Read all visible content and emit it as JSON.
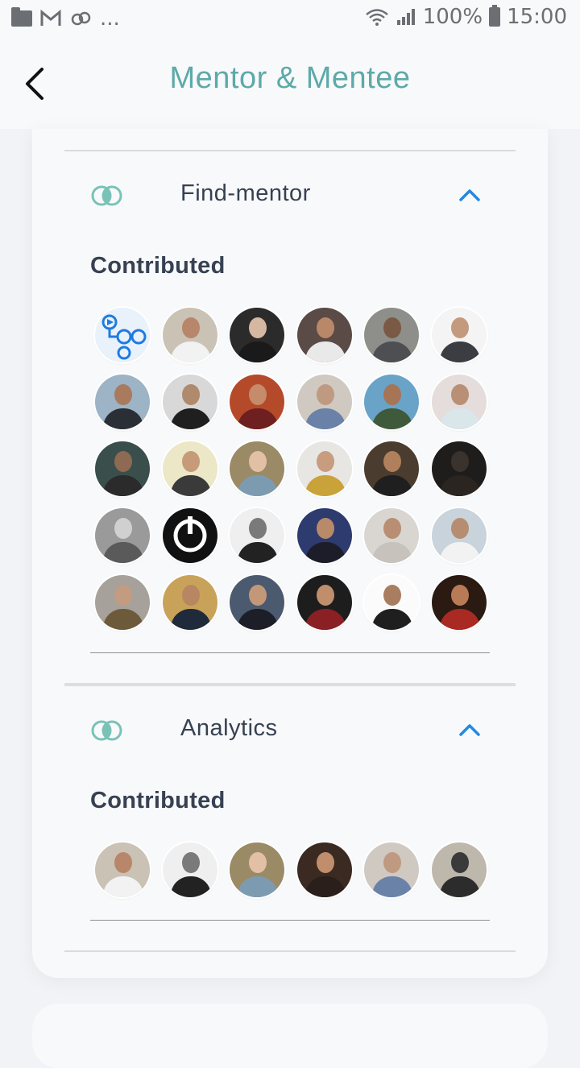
{
  "status_bar": {
    "left_overflow": "...",
    "battery": "100%",
    "time": "15:00"
  },
  "header": {
    "title": "Mentor & Mentee"
  },
  "sections": [
    {
      "title": "Find-mentor",
      "subheading": "Contributed",
      "avatars": [
        {
          "bg": "#e9f1fb",
          "head": "#1e7be0",
          "body": "#1e7be0",
          "kind": "logo"
        },
        {
          "bg": "#c9c2b5",
          "head": "#b8866a",
          "body": "#f2f2f2"
        },
        {
          "bg": "#2b2b2b",
          "head": "#d6b7a2",
          "body": "#1a1a1a"
        },
        {
          "bg": "#5a4b46",
          "head": "#b98868",
          "body": "#e9e9e9"
        },
        {
          "bg": "#8e8f8a",
          "head": "#7a5a44",
          "body": "#4d4f52"
        },
        {
          "bg": "#f4f4f4",
          "head": "#c49a7e",
          "body": "#3b3d42"
        },
        {
          "bg": "#9db3c6",
          "head": "#a87a5e",
          "body": "#2a2f36"
        },
        {
          "bg": "#d8d8d8",
          "head": "#b08a6d",
          "body": "#1f1f1f"
        },
        {
          "bg": "#b54a2a",
          "head": "#c68b6a",
          "body": "#6e1f1f"
        },
        {
          "bg": "#cfc9c2",
          "head": "#c09a80",
          "body": "#6a82a8"
        },
        {
          "bg": "#6aa3c8",
          "head": "#a57556",
          "body": "#3f5a3a"
        },
        {
          "bg": "#e5dcdc",
          "head": "#b98f76",
          "body": "#d9e6ea"
        },
        {
          "bg": "#3a4e4c",
          "head": "#8e6a52",
          "body": "#2b2b2b"
        },
        {
          "bg": "#ece7c6",
          "head": "#c79a78",
          "body": "#3a3a3a"
        },
        {
          "bg": "#9b8a66",
          "head": "#e2c0a6",
          "body": "#7d9bb0"
        },
        {
          "bg": "#e8e6e3",
          "head": "#c89c7f",
          "body": "#c9a23a"
        },
        {
          "bg": "#4a3c2f",
          "head": "#b07f5c",
          "body": "#1f1f1f"
        },
        {
          "bg": "#1f1d1b",
          "head": "#3a322c",
          "body": "#2a2520"
        },
        {
          "bg": "#9a9a9a",
          "head": "#d0d0d0",
          "body": "#5a5a5a"
        },
        {
          "bg": "#111111",
          "head": "#ffffff",
          "body": "#ffffff",
          "kind": "logo-dark"
        },
        {
          "bg": "#efefef",
          "head": "#7a7a7a",
          "body": "#222222"
        },
        {
          "bg": "#2d3b6e",
          "head": "#b88a6a",
          "body": "#1d1d2a"
        },
        {
          "bg": "#d9d6d2",
          "head": "#b98e72",
          "body": "#c7c2bb"
        },
        {
          "bg": "#c8d3db",
          "head": "#b68d70",
          "body": "#f2f2f2"
        },
        {
          "bg": "#a6a19a",
          "head": "#c39b80",
          "body": "#6d5a3a"
        },
        {
          "bg": "#c9a25a",
          "head": "#b88662",
          "body": "#1f2a3a"
        },
        {
          "bg": "#4c5a70",
          "head": "#c29878",
          "body": "#1c1f27"
        },
        {
          "bg": "#1d1d1d",
          "head": "#c08e6c",
          "body": "#8a1f24"
        },
        {
          "bg": "#fbfbfb",
          "head": "#a97d60",
          "body": "#1f1f1f"
        },
        {
          "bg": "#2a1a12",
          "head": "#b97a56",
          "body": "#a82a22"
        }
      ]
    },
    {
      "title": "Analytics",
      "subheading": "Contributed",
      "avatars": [
        {
          "bg": "#c9c2b5",
          "head": "#b8866a",
          "body": "#f2f2f2"
        },
        {
          "bg": "#efefef",
          "head": "#7a7a7a",
          "body": "#222222"
        },
        {
          "bg": "#9b8a66",
          "head": "#e2c0a6",
          "body": "#7d9bb0"
        },
        {
          "bg": "#3a2a22",
          "head": "#c08e6c",
          "body": "#2a1f1a"
        },
        {
          "bg": "#cfc9c2",
          "head": "#c09a80",
          "body": "#6a82a8"
        },
        {
          "bg": "#bdb7ac",
          "head": "#3a3a3a",
          "body": "#2c2c2c"
        }
      ]
    }
  ]
}
